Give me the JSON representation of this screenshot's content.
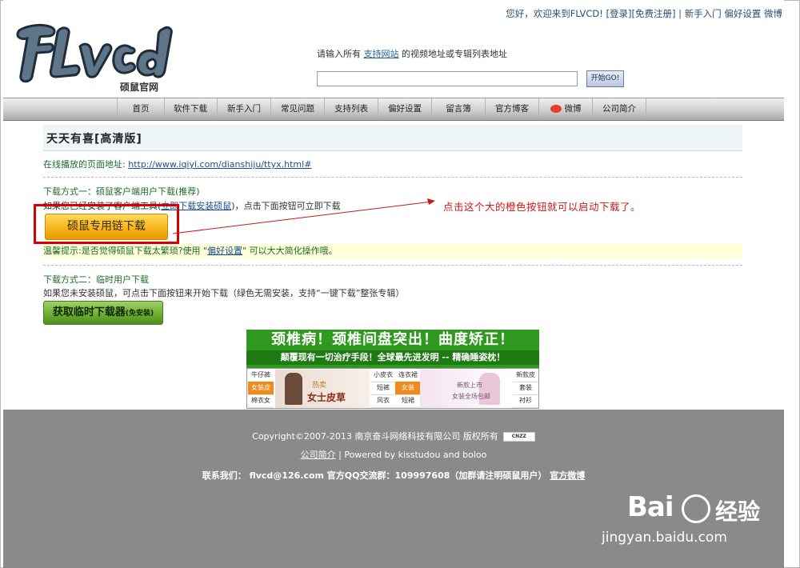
{
  "header": {
    "greeting": "您好，欢迎来到FLVCD!",
    "login": "[登录]",
    "register": "[免费注册]",
    "sep": "|",
    "beginner": "新手入门",
    "preferences": "偏好设置",
    "weibo": "微博",
    "logo_text": "FLVcd",
    "logo_sub": "硕鼠官网"
  },
  "search": {
    "hint_before": "请输入所有",
    "hint_link": "支持网站",
    "hint_after": "的视频地址或专辑列表地址",
    "value": "",
    "button_label": "开始GO!"
  },
  "nav": {
    "items": [
      {
        "label": "首页"
      },
      {
        "label": "软件下载"
      },
      {
        "label": "新手入门"
      },
      {
        "label": "常见问题"
      },
      {
        "label": "支持列表"
      },
      {
        "label": "偏好设置"
      },
      {
        "label": "留言簿"
      },
      {
        "label": "官方博客"
      },
      {
        "label": "微博"
      },
      {
        "label": "公司简介"
      }
    ]
  },
  "main": {
    "title": "天天有喜[高清版]",
    "address_label": "在线播放的页面地址:",
    "address_url": "http://www.iqiyi.com/dianshiju/ttyx.html#",
    "method1_title": "下载方式一：硕鼠客户端用户下载(推荐)",
    "method1_desc_before": "如果您已经安装了客户端工具(",
    "method1_desc_link": "立即下载安装硕鼠",
    "method1_desc_after": ")，点击下面按钮可立即下载",
    "orange_button": "硕鼠专用链下载",
    "tip_before": "温馨提示:是否觉得硕鼠下载太繁琐?使用 \"",
    "tip_link": "偏好设置",
    "tip_after": "\" 可以大大简化操作哦。",
    "method2_title": "下载方式二：临时用户下载",
    "method2_desc": "如果您未安装硕鼠，可点击下面按钮来开始下载（绿色无需安装，支持“一键下载”整张专辑）",
    "green_button": "获取临时下载器",
    "green_button_small": "(免安装)",
    "annotation": "点击这个大的橙色按钮就可以启动下载了。"
  },
  "ad": {
    "headline": "颈椎病！颈椎间盘突出！曲度矫正！",
    "subline": "颠覆现有一切治疗手段！全球最先进发明 -- 精确睡姿枕！",
    "left_cells": [
      "牛仔裤",
      "女装皮",
      "棉衣女"
    ],
    "mid_cells_a": [
      "小皮衣",
      "短裤",
      "风衣"
    ],
    "mid_cells_b": [
      "连衣裙",
      "女装",
      "短裙"
    ],
    "right_cells": [
      "新款皮",
      "套装",
      "衬衫"
    ],
    "img1_small": "热卖",
    "img1_big": "女士皮草",
    "img2_small": "新款上市",
    "img2_caption": "女装全场包邮"
  },
  "footer": {
    "copyright": "Copyright©2007-2013 南京奋斗网络科技有限公司 版权所有",
    "cnzz": "CNZZ",
    "company_link": "公司简介",
    "powered": " | Powered by kisstudou and boloo",
    "contact": "联系我们： flvcd@126.com 官方QQ交流群：109997608（加群请注明硕鼠用户）",
    "weibo_link": "官方微博"
  },
  "watermark": {
    "brand": "Bai",
    "brand2": "经验",
    "url": "jingyan.baidu.com"
  },
  "colors": {
    "nav_bg": "#c8c8c8",
    "accent_green": "#1e6b2a",
    "orange_button": "#f5b318",
    "annotation_red": "#d01818",
    "footer_bg": "#8a8a8a"
  }
}
